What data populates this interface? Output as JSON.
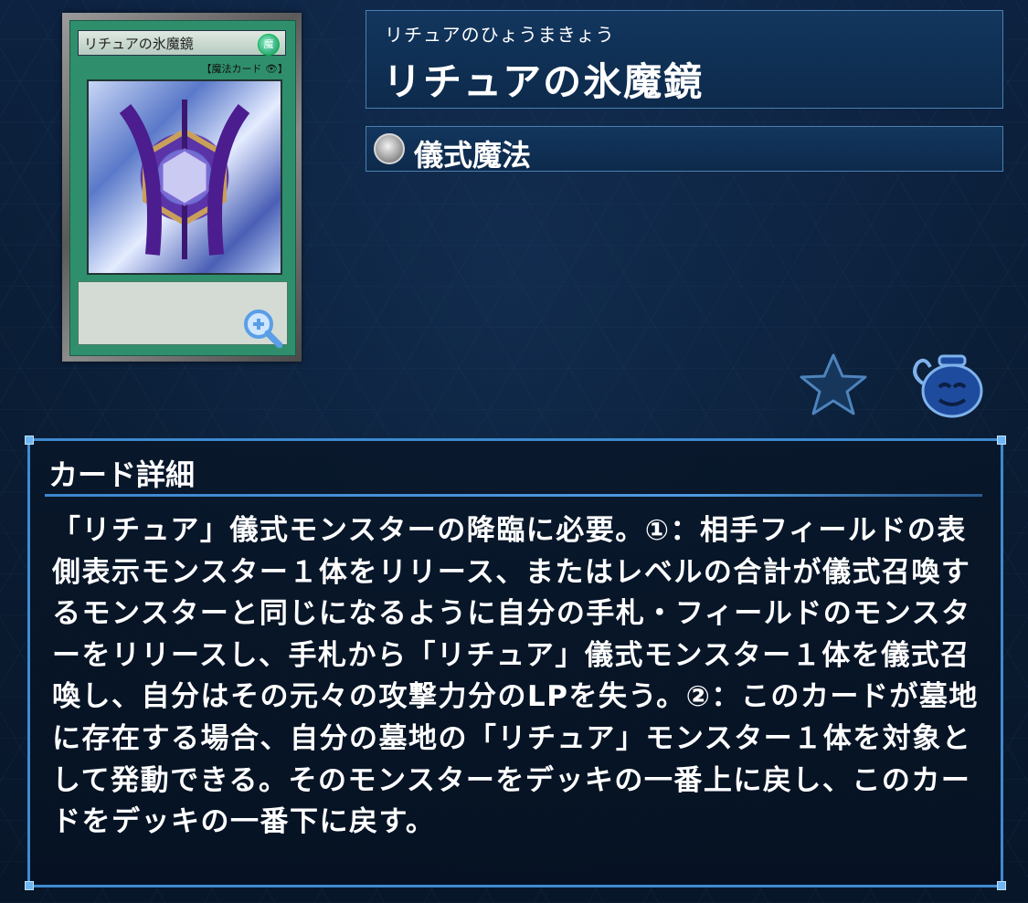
{
  "card": {
    "name": "リチュアの氷魔鏡",
    "reading": "リチュアのひょうまきょう",
    "type_label": "儀式魔法",
    "image": {
      "card_name_text": "リチュアの氷魔鏡",
      "attribute_text": "魔",
      "type_text": "【魔法カード 👁】"
    }
  },
  "detail": {
    "heading": "カード詳細",
    "text": "「リチュア」儀式モンスターの降臨に必要。①：相手フィールドの表側表示モンスター１体をリリース、またはレベルの合計が儀式召喚するモンスターと同じになるように自分の手札・フィールドのモンスターをリリースし、手札から「リチュア」儀式モンスター１体を儀式召喚し、自分はその元々の攻撃力分のLPを失う。②：このカードが墓地に存在する場合、自分の墓地の「リチュア」モンスター１体を対象として発動できる。そのモンスターをデッキの一番上に戻し、このカードをデッキの一番下に戻す。"
  },
  "icons": {
    "zoom": "zoom-in-icon",
    "favorite": "star-icon",
    "pot": "pot-of-greed-icon",
    "spell_type": "ritual-spell-icon"
  },
  "colors": {
    "accent": "#3e8ad0",
    "plate": "#12365e",
    "card_green": "#2f8f6d"
  }
}
